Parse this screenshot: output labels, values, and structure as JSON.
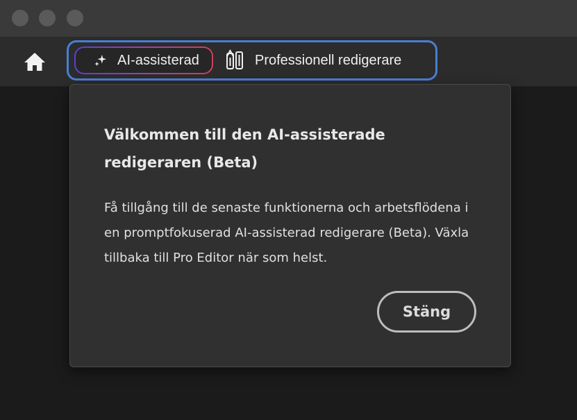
{
  "window": {
    "traffic_lights": [
      "close",
      "minimize",
      "zoom"
    ]
  },
  "appbar": {
    "home_icon": "home-icon",
    "modes": {
      "ai": {
        "label": "AI-assisterad",
        "icon": "sparkle-icon",
        "selected": true
      },
      "pro": {
        "label": "Professionell redigerare",
        "icon": "editor-tools-icon",
        "selected": false
      }
    }
  },
  "popover": {
    "title": "Välkommen till den AI-assisterade redigeraren (Beta)",
    "body": "Få tillgång till de senaste funktionerna och arbetsflödena i en promptfokuserad AI-assisterad redigerare (Beta). Växla tillbaka till Pro Editor när som helst.",
    "close_label": "Stäng"
  },
  "colors": {
    "switcher_border": "#4a7fd6",
    "ai_gradient_start": "#5b3fd9",
    "ai_gradient_end": "#d0405a",
    "background": "#1b1b1b",
    "popover_bg": "#303030"
  }
}
